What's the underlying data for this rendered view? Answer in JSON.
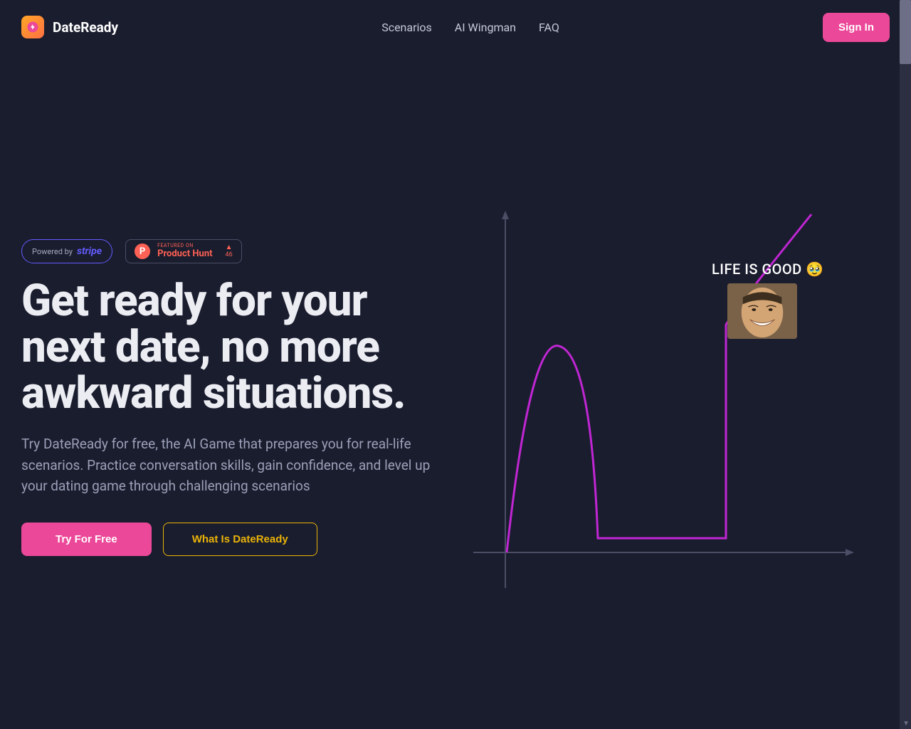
{
  "brand": {
    "name": "DateReady"
  },
  "nav": {
    "links": [
      {
        "label": "Scenarios"
      },
      {
        "label": "AI Wingman"
      },
      {
        "label": "FAQ"
      }
    ],
    "sign_in": "Sign In"
  },
  "badges": {
    "stripe": {
      "powered": "Powered by",
      "logo": "stripe"
    },
    "producthunt": {
      "featured": "FEATURED ON",
      "name": "Product Hunt",
      "count": "46"
    }
  },
  "hero": {
    "title": "Get ready for your next date, no more awkward situations.",
    "subtitle": "Try DateReady for free, the AI Game that prepares you for real-life scenarios. Practice conversation skills, gain confidence, and level up your dating game through challenging scenarios",
    "try_btn": "Try For Free",
    "what_btn": "What Is DateReady"
  },
  "graph": {
    "annotation": "LIFE IS GOOD 🥹"
  },
  "colors": {
    "accent_pink": "#ec4899",
    "accent_purple": "#c026d3",
    "accent_yellow": "#eab308",
    "bg": "#1a1d2e"
  }
}
